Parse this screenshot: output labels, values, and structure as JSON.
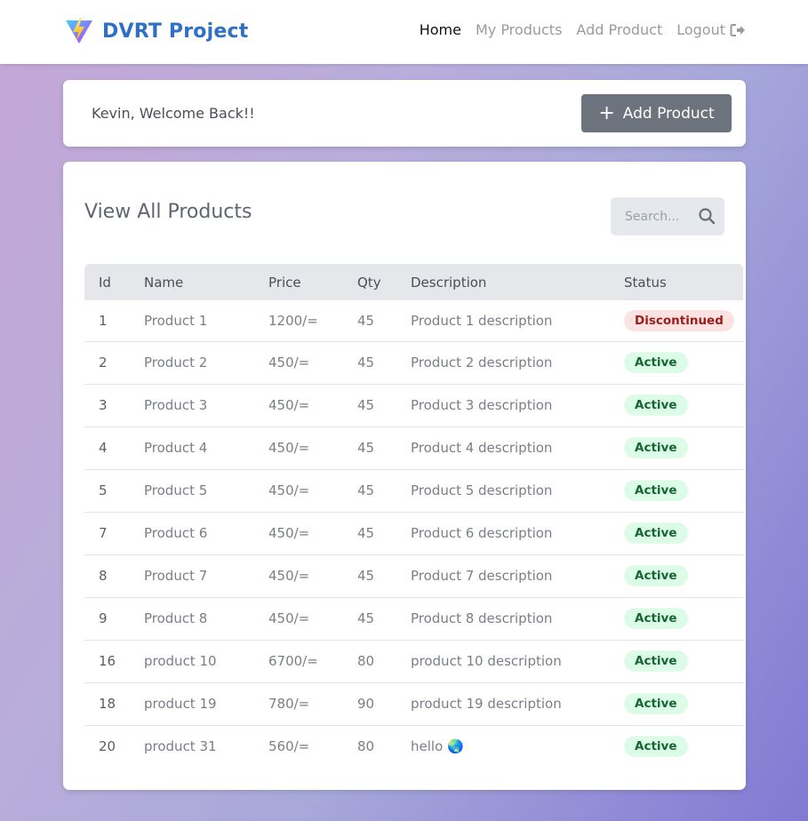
{
  "header": {
    "brand": "DVRT Project",
    "nav": [
      {
        "label": "Home",
        "active": true
      },
      {
        "label": "My Products",
        "active": false
      },
      {
        "label": "Add Product",
        "active": false
      },
      {
        "label": "Logout",
        "active": false,
        "icon": "logout-icon"
      }
    ]
  },
  "welcome": {
    "text": "Kevin, Welcome Back!!",
    "add_button": "Add Product"
  },
  "products": {
    "title": "View All Products",
    "search_placeholder": "Search...",
    "columns": [
      "Id",
      "Name",
      "Price",
      "Qty",
      "Description",
      "Status"
    ],
    "rows": [
      {
        "id": "1",
        "name": "Product 1",
        "price": "1200/=",
        "qty": "45",
        "description": "Product 1 description",
        "status": "Discontinued"
      },
      {
        "id": "2",
        "name": "Product 2",
        "price": "450/=",
        "qty": "45",
        "description": "Product 2 description",
        "status": "Active"
      },
      {
        "id": "3",
        "name": "Product 3",
        "price": "450/=",
        "qty": "45",
        "description": "Product 3 description",
        "status": "Active"
      },
      {
        "id": "4",
        "name": "Product 4",
        "price": "450/=",
        "qty": "45",
        "description": "Product 4 description",
        "status": "Active"
      },
      {
        "id": "5",
        "name": "Product 5",
        "price": "450/=",
        "qty": "45",
        "description": "Product 5 description",
        "status": "Active"
      },
      {
        "id": "7",
        "name": "Product 6",
        "price": "450/=",
        "qty": "45",
        "description": "Product 6 description",
        "status": "Active"
      },
      {
        "id": "8",
        "name": "Product 7",
        "price": "450/=",
        "qty": "45",
        "description": "Product 7 description",
        "status": "Active"
      },
      {
        "id": "9",
        "name": "Product 8",
        "price": "450/=",
        "qty": "45",
        "description": "Product 8 description",
        "status": "Active"
      },
      {
        "id": "16",
        "name": "product 10",
        "price": "6700/=",
        "qty": "80",
        "description": "product 10 description",
        "status": "Active"
      },
      {
        "id": "18",
        "name": "product 19",
        "price": "780/=",
        "qty": "90",
        "description": "product 19 description",
        "status": "Active"
      },
      {
        "id": "20",
        "name": "product 31",
        "price": "560/=",
        "qty": "80",
        "description": "hello 🌏",
        "status": "Active"
      }
    ]
  },
  "colors": {
    "brand": "#2f6fc6",
    "button": "#6c737d",
    "active_badge_bg": "#dcfce7",
    "active_badge_text": "#166534",
    "discontinued_badge_bg": "#fde2e2",
    "discontinued_badge_text": "#9b1c1c"
  }
}
